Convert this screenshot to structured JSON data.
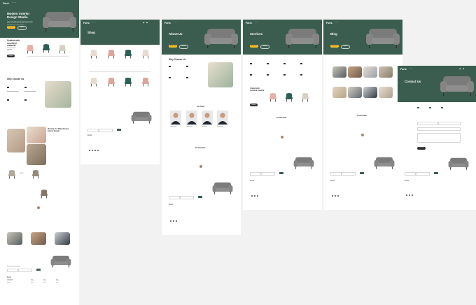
{
  "brand": "Furni.",
  "brand_alt": "Furni",
  "home": {
    "hero_title": "Modern Interior Design Studio",
    "hero_text": "Donec vitae odio quis nisl dapibus malesuada. Nullam ac aliquet velit. Aliquam vulputate velit imperdiet dolor tempor tristique.",
    "shop_btn": "Shop Now",
    "explore_btn": "Explore",
    "crafted_title": "Crafted with excellent material.",
    "choose_title": "Why Choose Us",
    "help_title": "We Help You Make Modern Interior Design",
    "explore_action": "Explore"
  },
  "page_titles": {
    "shop": "Shop",
    "about": "About Us",
    "services": "Services",
    "blog": "Blog",
    "contact": "Contact Us"
  },
  "sections": {
    "team": "Our Team",
    "testimonials": "Testimonials",
    "newsletter": "Subscribe to Newsletter",
    "send": "Send Message"
  },
  "team": [
    {
      "name": "Lawson Arnold",
      "role": "CEO, Founder, Atty."
    },
    {
      "name": "Jeremy Walker",
      "role": "CEO, Founder, Atty."
    },
    {
      "name": "Patrik White",
      "role": "CEO, Founder, Atty."
    },
    {
      "name": "Kathryn Ryan",
      "role": "CEO, Founder, Atty."
    }
  ],
  "product_price": "$50.00",
  "colors": {
    "green": "#3b5d50",
    "yellow": "#f9bf29",
    "dark": "#2f2f2f",
    "canvas": "#f2f2f2"
  }
}
